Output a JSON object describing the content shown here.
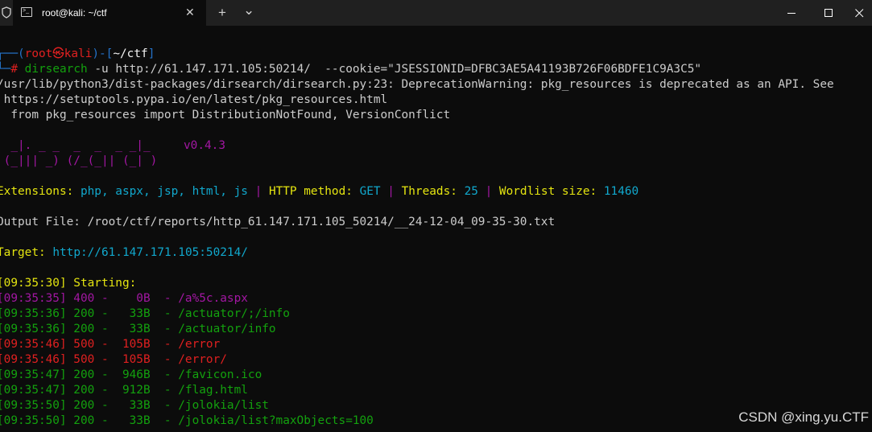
{
  "window": {
    "tab_title": "root@kali: ~/ctf",
    "new_tab_label": "+",
    "dropdown_label": "⌄",
    "close_tab_label": "✕",
    "minimize_label": "—",
    "close_label": "✕"
  },
  "prompt": {
    "open": "┌──(",
    "user": "root㉿kali",
    "mid": ")-[",
    "path": "~/ctf",
    "close": "]",
    "line2_prefix": "└─",
    "hash": "#",
    "command": "dirsearch",
    "args": "-u http://61.147.171.105:50214/  --cookie=\"JSESSIONID=DFBC3AE5A41193B726F06BDFE1C9A3C5\""
  },
  "warning": {
    "line1": "/usr/lib/python3/dist-packages/dirsearch/dirsearch.py:23: DeprecationWarning: pkg_resources is deprecated as an API. See",
    "line2": " https://setuptools.pypa.io/en/latest/pkg_resources.html",
    "line3": "  from pkg_resources import DistributionNotFound, VersionConflict"
  },
  "banner": {
    "art_line1": "  _|. _ _  _  _  _ _|_",
    "art_line2": " (_||| _) (/_(_|| (_| )",
    "version": "v0.4.3"
  },
  "config": {
    "extensions_label": "Extensions:",
    "extensions_value": "php, aspx, jsp, html, js",
    "method_label": "HTTP method:",
    "method_value": "GET",
    "threads_label": "Threads:",
    "threads_value": "25",
    "wordlist_label": "Wordlist size:",
    "wordlist_value": "11460",
    "separator": "|"
  },
  "output_file": "Output File: /root/ctf/reports/http_61.147.171.105_50214/__24-12-04_09-35-30.txt",
  "target": {
    "label": "Target:",
    "url": "http://61.147.171.105:50214/"
  },
  "starting": "[09:35:30] Starting:",
  "results": [
    {
      "text": "[09:35:35] 400 -    0B  - /a%5c.aspx",
      "color": "#a317a3"
    },
    {
      "text": "[09:35:36] 200 -   33B  - /actuator/;/info",
      "color": "#13a10e"
    },
    {
      "text": "[09:35:36] 200 -   33B  - /actuator/info",
      "color": "#13a10e"
    },
    {
      "text": "[09:35:46] 500 -  105B  - /error",
      "color": "#e02020"
    },
    {
      "text": "[09:35:46] 500 -  105B  - /error/",
      "color": "#e02020"
    },
    {
      "text": "[09:35:47] 200 -  946B  - /favicon.ico",
      "color": "#13a10e"
    },
    {
      "text": "[09:35:47] 200 -  912B  - /flag.html",
      "color": "#13a10e"
    },
    {
      "text": "[09:35:50] 200 -   33B  - /jolokia/list",
      "color": "#13a10e"
    },
    {
      "text": "[09:35:50] 200 -   33B  - /jolokia/list?maxObjects=100",
      "color": "#13a10e"
    }
  ],
  "watermark": "CSDN @xing.yu.CTF"
}
